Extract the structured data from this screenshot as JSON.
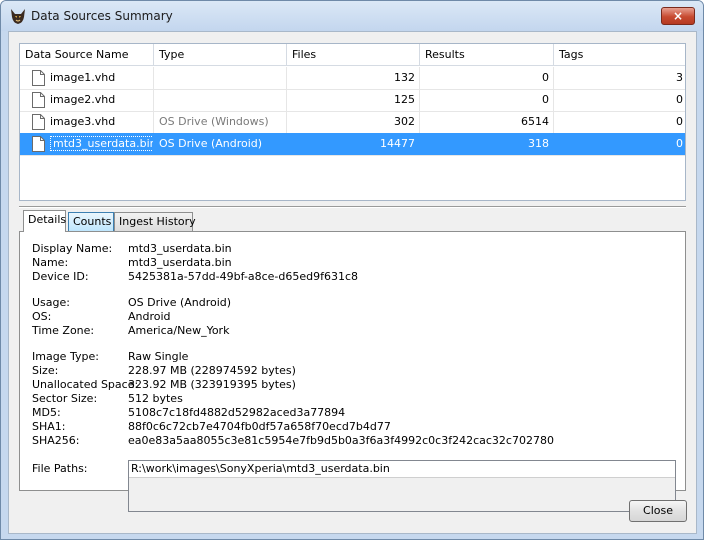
{
  "window": {
    "title": "Data Sources Summary",
    "close_glyph": "×",
    "icon": "autopsy-dog-icon"
  },
  "table": {
    "columns": [
      "Data Source Name",
      "Type",
      "Files",
      "Results",
      "Tags"
    ],
    "rows": [
      {
        "name": "image1.vhd",
        "type": "",
        "files": "132",
        "results": "0",
        "tags": "3",
        "selected": false
      },
      {
        "name": "image2.vhd",
        "type": "",
        "files": "125",
        "results": "0",
        "tags": "0",
        "selected": false
      },
      {
        "name": "image3.vhd",
        "type": "OS Drive (Windows)",
        "files": "302",
        "results": "6514",
        "tags": "0",
        "selected": false
      },
      {
        "name": "mtd3_userdata.bin",
        "type": "OS Drive (Android)",
        "files": "14477",
        "results": "318",
        "tags": "0",
        "selected": true
      }
    ]
  },
  "tabs": [
    {
      "label": "Details",
      "active": true
    },
    {
      "label": "Counts",
      "active": false
    },
    {
      "label": "Ingest History",
      "active": false
    }
  ],
  "details": {
    "display_name_label": "Display Name:",
    "display_name": "mtd3_userdata.bin",
    "name_label": "Name:",
    "name": "mtd3_userdata.bin",
    "device_id_label": "Device ID:",
    "device_id": "5425381a-57dd-49bf-a8ce-d65ed9f631c8",
    "usage_label": "Usage:",
    "usage": "OS Drive (Android)",
    "os_label": "OS:",
    "os": "Android",
    "timezone_label": "Time Zone:",
    "timezone": "America/New_York",
    "image_type_label": "Image Type:",
    "image_type": "Raw Single",
    "size_label": "Size:",
    "size": "228.97 MB (228974592 bytes)",
    "unallocated_label": "Unallocated Space:",
    "unallocated": "323.92 MB (323919395 bytes)",
    "sector_size_label": "Sector Size:",
    "sector_size": "512 bytes",
    "md5_label": "MD5:",
    "md5": "5108c7c18fd4882d52982aced3a77894",
    "sha1_label": "SHA1:",
    "sha1": "88f0c6c72cb7e4704fb0df57a658f70ecd7b4d77",
    "sha256_label": "SHA256:",
    "sha256": "ea0e83a5aa8055c3e81c5954e7fb9d5b0a3f6a3f4992c0c3f242cac32c702780",
    "file_paths_label": "File Paths:",
    "file_paths": [
      "R:\\work\\images\\SonyXperia\\mtd3_userdata.bin"
    ]
  },
  "buttons": {
    "close": "Close"
  },
  "colors": {
    "selection": "#3399ff",
    "title_bg": "#c3d6ee",
    "close_red": "#c74a30"
  }
}
